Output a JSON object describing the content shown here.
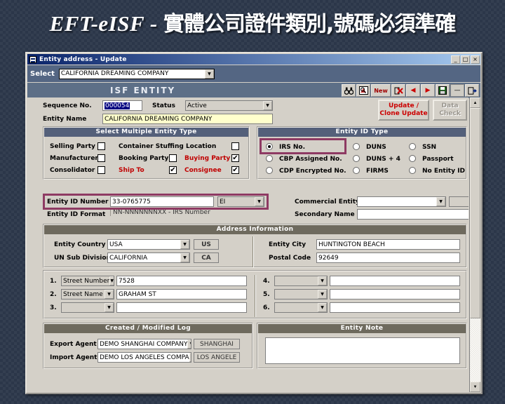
{
  "slide": {
    "title_latin": "EFT-eISF - ",
    "title_cjk": "實體公司證件類別,號碼必須準確"
  },
  "window": {
    "title": "Entity address - Update",
    "minimize_label": "_",
    "maximize_label": "□",
    "close_label": "×",
    "titlebar_icon": "grid-icon"
  },
  "select_bar": {
    "label": "Select",
    "value": "CALIFORNIA DREAMING COMPANY",
    "arrow": "▼"
  },
  "isf_toolbar": {
    "title": "ISF ENTITY",
    "buttons": [
      {
        "name": "find-icon",
        "label": "AA",
        "glyph": "🔍"
      },
      {
        "name": "query-icon",
        "label": "⌕"
      },
      {
        "name": "new-button",
        "label": "New"
      },
      {
        "name": "delete-icon",
        "label": "✗"
      },
      {
        "name": "prev-record-icon",
        "label": "◀"
      },
      {
        "name": "next-record-icon",
        "label": "▶"
      },
      {
        "name": "save-icon",
        "label": "▤"
      },
      {
        "name": "minimize-icon",
        "label": "—"
      },
      {
        "name": "exit-icon",
        "label": "⇥"
      }
    ]
  },
  "header_fields": {
    "sequence_label": "Sequence No.",
    "sequence_value": "000054",
    "status_label": "Status",
    "status_value": "Active",
    "entity_name_label": "Entity Name",
    "entity_name_value": "CALIFORNIA DREAMING COMPANY",
    "update_button": "Update /",
    "update_button2": "Clone Update",
    "data_check_button": "Data",
    "data_check_button2": "Check"
  },
  "entity_type_panel": {
    "title": "Select Multiple Entity Type",
    "items": [
      {
        "label": "Selling Party",
        "checked": false,
        "red": false
      },
      {
        "label": "Container Stuffing Location",
        "checked": false,
        "red": false
      },
      {
        "label": "Manufacturer",
        "checked": false,
        "red": false
      },
      {
        "label": "Booking Party",
        "checked": false,
        "red": false
      },
      {
        "label": "Buying Party",
        "checked": true,
        "red": true
      },
      {
        "label": "Consolidator",
        "checked": false,
        "red": false
      },
      {
        "label": "Ship To",
        "checked": true,
        "red": true
      },
      {
        "label": "Consignee",
        "checked": true,
        "red": true
      }
    ]
  },
  "entity_id_type_panel": {
    "title": "Entity ID Type",
    "options": [
      {
        "label": "IRS No.",
        "selected": true
      },
      {
        "label": "DUNS",
        "selected": false
      },
      {
        "label": "SSN",
        "selected": false
      },
      {
        "label": "CBP Assigned No.",
        "selected": false
      },
      {
        "label": "DUNS + 4",
        "selected": false
      },
      {
        "label": "Passport",
        "selected": false
      },
      {
        "label": "CDP Encrypted No.",
        "selected": false
      },
      {
        "label": "FIRMS",
        "selected": false
      },
      {
        "label": "No Entity ID",
        "selected": false
      }
    ]
  },
  "entity_id_row": {
    "number_label": "Entity ID Number",
    "number_value": "33-0765775",
    "type_code": "EI",
    "format_label": "Entity ID Format",
    "format_value": "NN-NNNNNNNXX  -  IRS Number",
    "commercial_entity_label": "Commercial Entity",
    "commercial_entity_value": "",
    "commercial_entity_code": "",
    "secondary_name_label": "Secondary Name",
    "secondary_name_value": ""
  },
  "address_panel": {
    "title": "Address Information",
    "country_label": "Entity Country",
    "country_value": "USA",
    "country_code": "US",
    "subdivision_label": "UN Sub Division",
    "subdivision_value": "CALIFORNIA",
    "subdivision_code": "CA",
    "city_label": "Entity City",
    "city_value": "HUNTINGTON BEACH",
    "postal_label": "Postal Code",
    "postal_value": "92649"
  },
  "address_lines": {
    "left": [
      {
        "num": "1.",
        "type": "Street Number",
        "value": "7528"
      },
      {
        "num": "2.",
        "type": "Street Name",
        "value": "GRAHAM ST"
      },
      {
        "num": "3.",
        "type": "",
        "value": ""
      }
    ],
    "right": [
      {
        "num": "4.",
        "type": "",
        "value": ""
      },
      {
        "num": "5.",
        "type": "",
        "value": ""
      },
      {
        "num": "6.",
        "type": "",
        "value": ""
      }
    ]
  },
  "log_panel": {
    "title": "Created / Modified Log",
    "export_label": "Export Agent",
    "export_value": "DEMO SHANGHAI COMPANY",
    "export_code": "SHANGHAI",
    "import_label": "Import Agent",
    "import_value": "DEMO LOS ANGELES COMPA",
    "import_code": "LOS ANGELE"
  },
  "note_panel": {
    "title": "Entity Note",
    "value": ""
  },
  "scrollbar": {
    "up_arrow": "▲",
    "down_arrow": "▼"
  },
  "colors": {
    "title_blue": "#0a246a",
    "highlight_purple": "#8e3a63",
    "red_text": "#c00000",
    "panel_face": "#d4d0c8"
  }
}
